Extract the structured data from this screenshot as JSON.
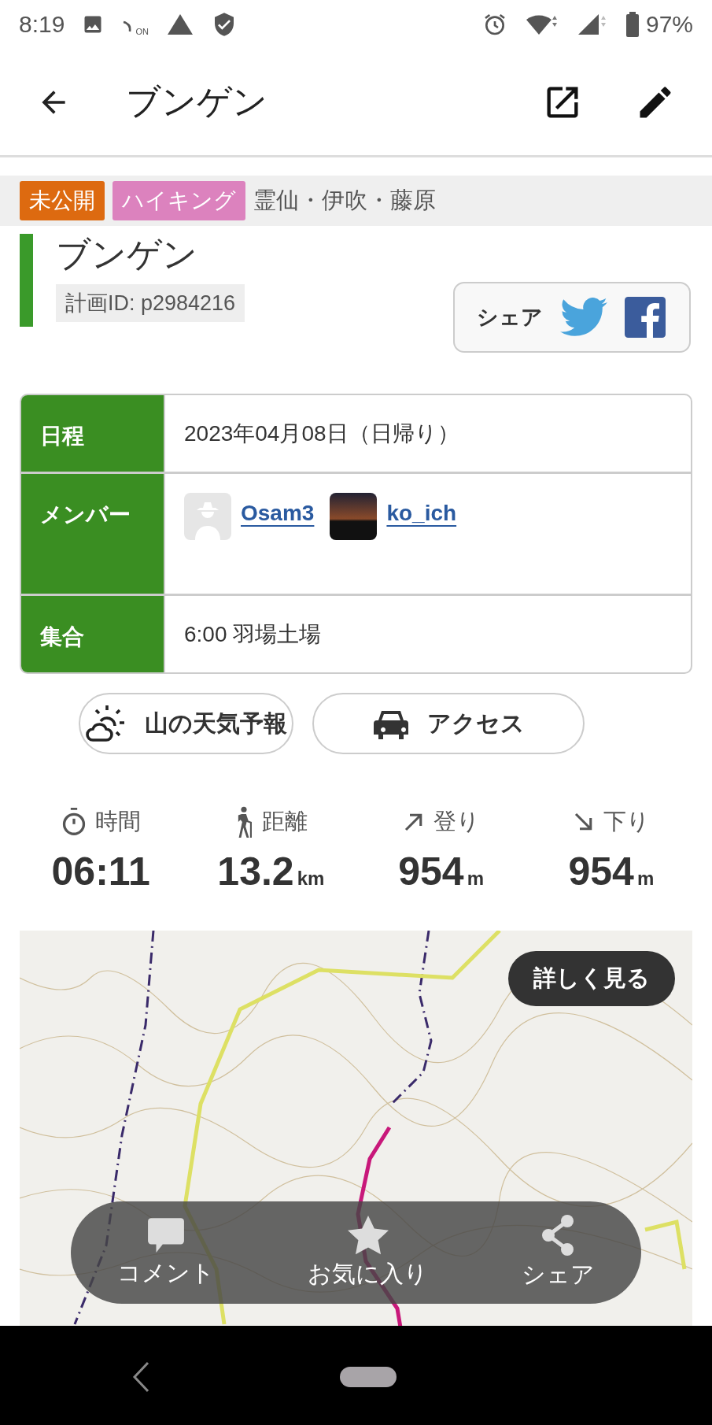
{
  "status_bar": {
    "time": "8:19",
    "nfc_label": "ON",
    "battery": "97%"
  },
  "app_bar": {
    "title": "ブンゲン"
  },
  "tags": [
    {
      "label": "未公開",
      "color": "#dd6a10"
    },
    {
      "label": "ハイキング",
      "color": "#dc82be"
    }
  ],
  "area": "霊仙・伊吹・藤原",
  "plan": {
    "title": "ブンゲン",
    "plan_id": "計画ID: p2984216",
    "share_label": "シェア"
  },
  "details": [
    {
      "kind": "text",
      "label": "日程",
      "value": "2023年04月08日（日帰り）"
    },
    {
      "kind": "members",
      "label": "メンバー",
      "members": [
        {
          "name": "Osam3",
          "kind": "silhouette"
        },
        {
          "name": "ko_ich",
          "kind": "photo"
        }
      ]
    },
    {
      "kind": "text",
      "label": "集合",
      "value": "6:00 羽場土場"
    }
  ],
  "actions": [
    {
      "kind": "weather",
      "label": "山の天気予報"
    },
    {
      "kind": "car",
      "label": "アクセス"
    }
  ],
  "stats": [
    {
      "kind": "time",
      "label": "時間",
      "value": "06:11"
    },
    {
      "kind": "distance",
      "label": "距離",
      "value": "13.2",
      "unit": "km"
    },
    {
      "kind": "up",
      "label": "登り",
      "value": "954",
      "unit": "m"
    },
    {
      "kind": "down",
      "label": "下り",
      "value": "954",
      "unit": "m"
    }
  ],
  "map": {
    "details_button": "詳しく見る"
  },
  "bottom_actions": [
    {
      "kind": "comment",
      "label": "コメント"
    },
    {
      "kind": "star",
      "label": "お気に入り"
    },
    {
      "kind": "share",
      "label": "シェア"
    }
  ]
}
